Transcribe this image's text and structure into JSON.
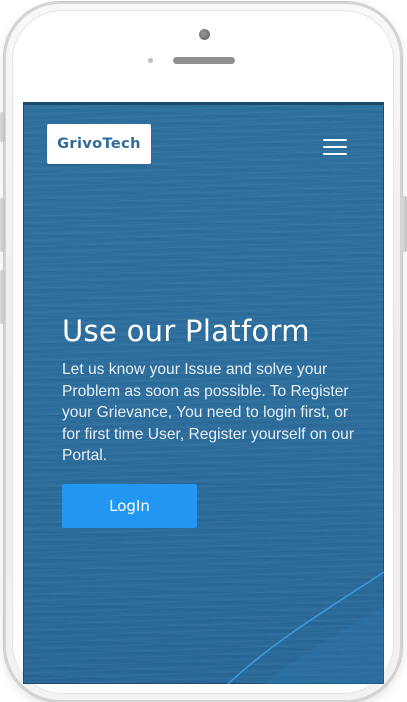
{
  "header": {
    "brand": "GrivoTech",
    "menu_icon": "hamburger-menu-icon"
  },
  "hero": {
    "title": "Use our Platform",
    "description": "Let us know your Issue and solve your Problem as soon as possible. To Register your Grievance, You need to login first, or for first time User, Register yourself on our Portal.",
    "login_label": "LogIn"
  },
  "colors": {
    "screen_background": "#2c6e9e",
    "button": "#2196f3",
    "brand_text": "#2f6b98"
  }
}
